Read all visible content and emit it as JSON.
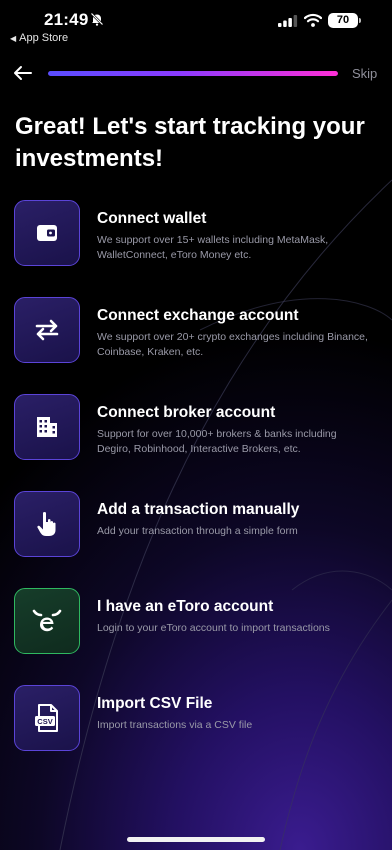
{
  "status_bar": {
    "time": "21:49",
    "back_app": "App Store",
    "battery": "70",
    "icons": [
      "bell-slash-icon",
      "signal-icon",
      "wifi-icon",
      "battery-icon"
    ]
  },
  "nav": {
    "skip_label": "Skip",
    "progress_fraction": 1.0
  },
  "headline": "Great! Let's start tracking your investments!",
  "options": [
    {
      "title": "Connect wallet",
      "description": "We support over 15+ wallets including MetaMask, WalletConnect, eToro Money etc.",
      "icon": "wallet-icon"
    },
    {
      "title": "Connect exchange account",
      "description": "We support over 20+ crypto exchanges including Binance, Coinbase, Kraken, etc.",
      "icon": "exchange-arrows-icon"
    },
    {
      "title": "Connect broker account",
      "description": "Support for over 10,000+ brokers & banks including Degiro, Robinhood, Interactive Brokers, etc.",
      "icon": "building-icon"
    },
    {
      "title": "Add a transaction manually",
      "description": "Add your transaction through a simple form",
      "icon": "hand-pointer-icon"
    },
    {
      "title": "I have an eToro account",
      "description": "Login to your eToro account to import transactions",
      "icon": "etoro-logo-icon"
    },
    {
      "title": "Import CSV File",
      "description": "Import transactions via a CSV file",
      "icon": "csv-file-icon",
      "icon_text": "CSV"
    }
  ],
  "colors": {
    "accent_purple": "#5b44d8",
    "accent_green": "#2fb860",
    "progress_start": "#5a4dff",
    "progress_end": "#ff2fd6"
  }
}
